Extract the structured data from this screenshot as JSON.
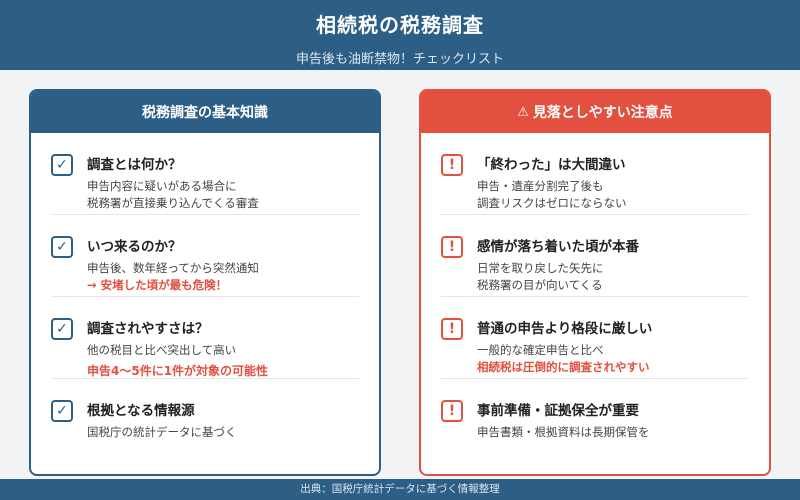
{
  "header": {
    "title": "相続税の税務調査",
    "subtitle": "申告後も油断禁物！チェックリスト"
  },
  "left_card": {
    "title": "税務調査の基本知識",
    "items": [
      {
        "title": "調査とは何か？",
        "lines": [
          "申告内容に疑いがある場合に",
          "税務署が直接乗り込んでくる審査"
        ]
      },
      {
        "title": "いつ来るのか？",
        "lines": [
          "申告後、数年経ってから突然通知"
        ],
        "alert": "→ 安堵した頃が最も危険！"
      },
      {
        "title": "調査されやすさは？",
        "lines": [
          "他の税目と比べ突出して高い"
        ],
        "alert": "申告4〜5件に1件が対象の可能性"
      },
      {
        "title": "根拠となる情報源",
        "lines": [
          "国税庁の統計データに基づく"
        ]
      }
    ]
  },
  "right_card": {
    "title": "見落としやすい注意点",
    "items": [
      {
        "title": "「終わった」は大間違い",
        "lines": [
          "申告・遺産分割完了後も",
          "調査リスクはゼロにならない"
        ]
      },
      {
        "title": "感情が落ち着いた頃が本番",
        "lines": [
          "日常を取り戻した矢先に",
          "税務署の目が向いてくる"
        ]
      },
      {
        "title": "普通の申告より格段に厳しい",
        "lines": [
          "一般的な確定申告と比べ"
        ],
        "alert": "相続税は圧倒的に調査されやすい"
      },
      {
        "title": "事前準備・証拠保全が重要",
        "lines": [
          "申告書類・根拠資料は長期保管を"
        ]
      }
    ]
  },
  "icons": {
    "check": "✓",
    "warn": "!",
    "triangle": "⚠"
  },
  "footer": {
    "text": "出典：国税庁統計データに基づく情報整理"
  },
  "colors": {
    "primary": "#2c5e86",
    "accent": "#e2503f"
  }
}
